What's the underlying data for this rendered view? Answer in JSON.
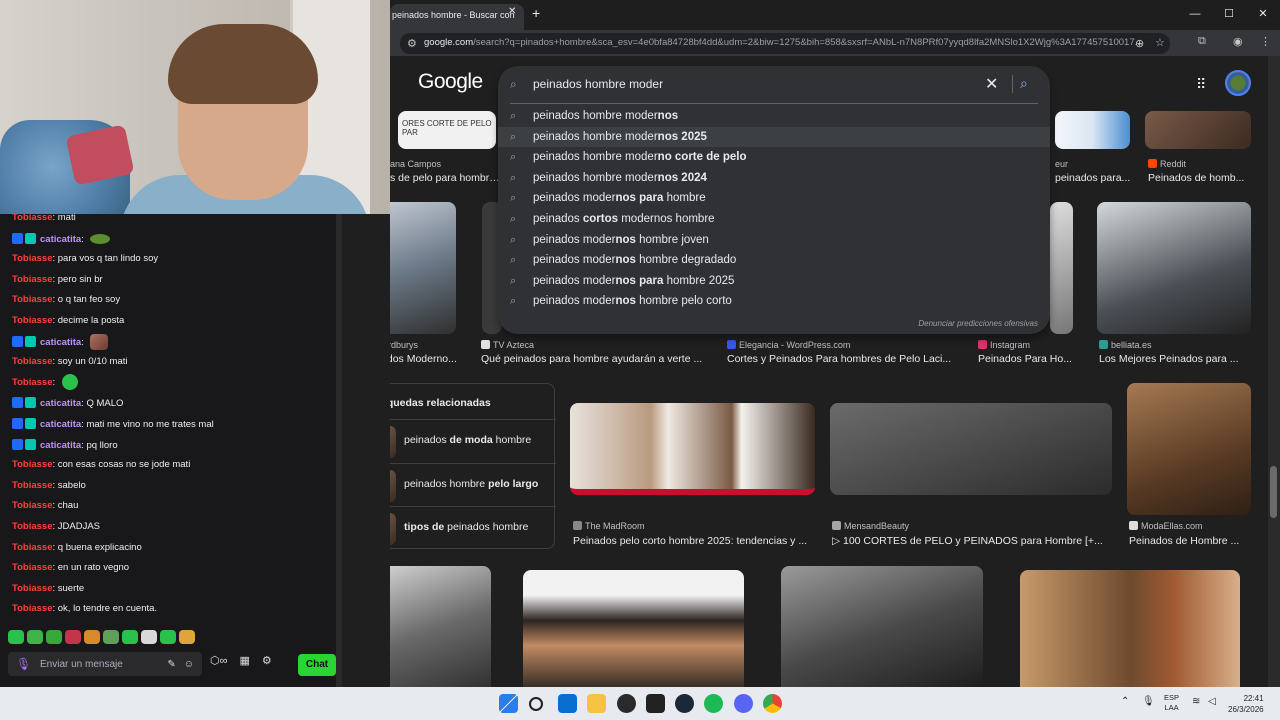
{
  "browser": {
    "tab_title": "peinados hombre - Buscar con",
    "tab_close": "✕",
    "new_tab": "+",
    "url_host": "google.com",
    "url_rest": "/search?q=pinados+hombre&sca_esv=4e0bfa84728bf4dd&udm=2&biw=1275&bih=858&sxsrf=ANbL-n7N8PRf07yyqd8lfa2MNSlo1X2Wjg%3A177457510017..."
  },
  "google": {
    "logo": "Google",
    "query": "peinados hombre moder",
    "suggestions": [
      {
        "pre": "peinados hombre moder",
        "bold": "nos",
        "post": ""
      },
      {
        "pre": "peinados hombre moder",
        "bold": "nos 2025",
        "post": ""
      },
      {
        "pre": "peinados hombre moder",
        "bold": "no corte de pelo",
        "post": ""
      },
      {
        "pre": "peinados hombre moder",
        "bold": "nos 2024",
        "post": ""
      },
      {
        "pre": "peinados moder",
        "bold": "nos para",
        "post": " hombre"
      },
      {
        "pre": "peinados ",
        "bold": "cortos",
        "post": " modernos hombre"
      },
      {
        "pre": "peinados moder",
        "bold": "nos",
        "post": " hombre joven"
      },
      {
        "pre": "peinados moder",
        "bold": "nos",
        "post": " hombre degradado"
      },
      {
        "pre": "peinados moder",
        "bold": "nos para",
        "post": " hombre 2025"
      },
      {
        "pre": "peinados moder",
        "bold": "nos",
        "post": " hombre pelo corto"
      }
    ],
    "report": "Denunciar predicciones ofensivas",
    "results_top_partial": [
      {
        "src": "ana Campos",
        "title": "s de pelo para hombres"
      },
      {
        "src": "eur",
        "title": "peinados para..."
      },
      {
        "src": "Reddit",
        "title": "Peinados de homb..."
      }
    ],
    "results_row1": [
      {
        "src": "Beardburys",
        "title": "Peinados Moderno..."
      },
      {
        "src": "TV Azteca",
        "title": "Qué peinados para hombre ayudarán a verte ..."
      },
      {
        "src": "Elegancia - WordPress.com",
        "title": "Cortes y Peinados Para hombres de Pelo Laci..."
      },
      {
        "src": "Instagram",
        "title": "Peinados Para Ho..."
      },
      {
        "src": "belliata.es",
        "title": "Los Mejores Peinados para ..."
      }
    ],
    "related_title": "Búsquedas relacionadas",
    "related": [
      {
        "pre": "peinados ",
        "bold": "de moda",
        "post": " hombre"
      },
      {
        "pre": "peinados hombre ",
        "bold": "pelo largo",
        "post": ""
      },
      {
        "pre": "",
        "bold": "tipos de",
        "post": " peinados hombre"
      }
    ],
    "results_row2": [
      {
        "src": "The MadRoom",
        "title": "Peinados pelo corto hombre 2025: tendencias y ..."
      },
      {
        "src": "MensandBeauty",
        "title": "▷ 100 CORTES de PELO y PEINADOS para Hombre [+..."
      },
      {
        "src": "ModaEllas.com",
        "title": "Peinados de Hombre ..."
      }
    ]
  },
  "chat": {
    "messages": [
      {
        "user": "Tobiasse",
        "color": "red",
        "text": "mati",
        "badges": false
      },
      {
        "user": "caticatita",
        "color": "purple",
        "text": "",
        "badges": true,
        "emote": "frog"
      },
      {
        "user": "Tobiasse",
        "color": "red",
        "text": "para vos q tan lindo soy",
        "badges": false
      },
      {
        "user": "Tobiasse",
        "color": "red",
        "text": "pero sin br",
        "badges": false
      },
      {
        "user": "Tobiasse",
        "color": "red",
        "text": "o q tan feo soy",
        "badges": false
      },
      {
        "user": "Tobiasse",
        "color": "red",
        "text": "decime la posta",
        "badges": false
      },
      {
        "user": "caticatita",
        "color": "purple",
        "text": "",
        "badges": true,
        "emote": "photo"
      },
      {
        "user": "Tobiasse",
        "color": "red",
        "text": "soy un 0/10 mati",
        "badges": false
      },
      {
        "user": "Tobiasse",
        "color": "red",
        "text": "",
        "badges": false,
        "emote": "green"
      },
      {
        "user": "caticatita",
        "color": "purple",
        "text": "Q MALO",
        "badges": true
      },
      {
        "user": "caticatita",
        "color": "purple",
        "text": "mati me vino no me trates mal",
        "badges": true
      },
      {
        "user": "caticatita",
        "color": "purple",
        "text": "pq lloro",
        "badges": true
      },
      {
        "user": "Tobiasse",
        "color": "red",
        "text": "con esas cosas no se jode mati",
        "badges": false
      },
      {
        "user": "Tobiasse",
        "color": "red",
        "text": "sabelo",
        "badges": false
      },
      {
        "user": "Tobiasse",
        "color": "red",
        "text": "chau",
        "badges": false
      },
      {
        "user": "Tobiasse",
        "color": "red",
        "text": "JDADJAS",
        "badges": false
      },
      {
        "user": "Tobiasse",
        "color": "red",
        "text": "q buena explicacino",
        "badges": false
      },
      {
        "user": "Tobiasse",
        "color": "red",
        "text": "en un rato vegno",
        "badges": false
      },
      {
        "user": "Tobiasse",
        "color": "red",
        "text": "suerte",
        "badges": false
      },
      {
        "user": "Tobiasse",
        "color": "red",
        "text": "ok, lo tendre en cuenta.",
        "badges": false
      }
    ],
    "input_placeholder": "Enviar un mensaje",
    "send_label": "Chat"
  },
  "taskbar": {
    "lang_top": "ESP",
    "lang_bottom": "LAA",
    "time": "22:41",
    "date": "26/3/2026"
  },
  "colors": {
    "twitch_red": "#ff3f3f",
    "twitch_purple": "#bf94ff",
    "chat_button": "#2bd435",
    "google_bg": "#1f1f1f"
  }
}
